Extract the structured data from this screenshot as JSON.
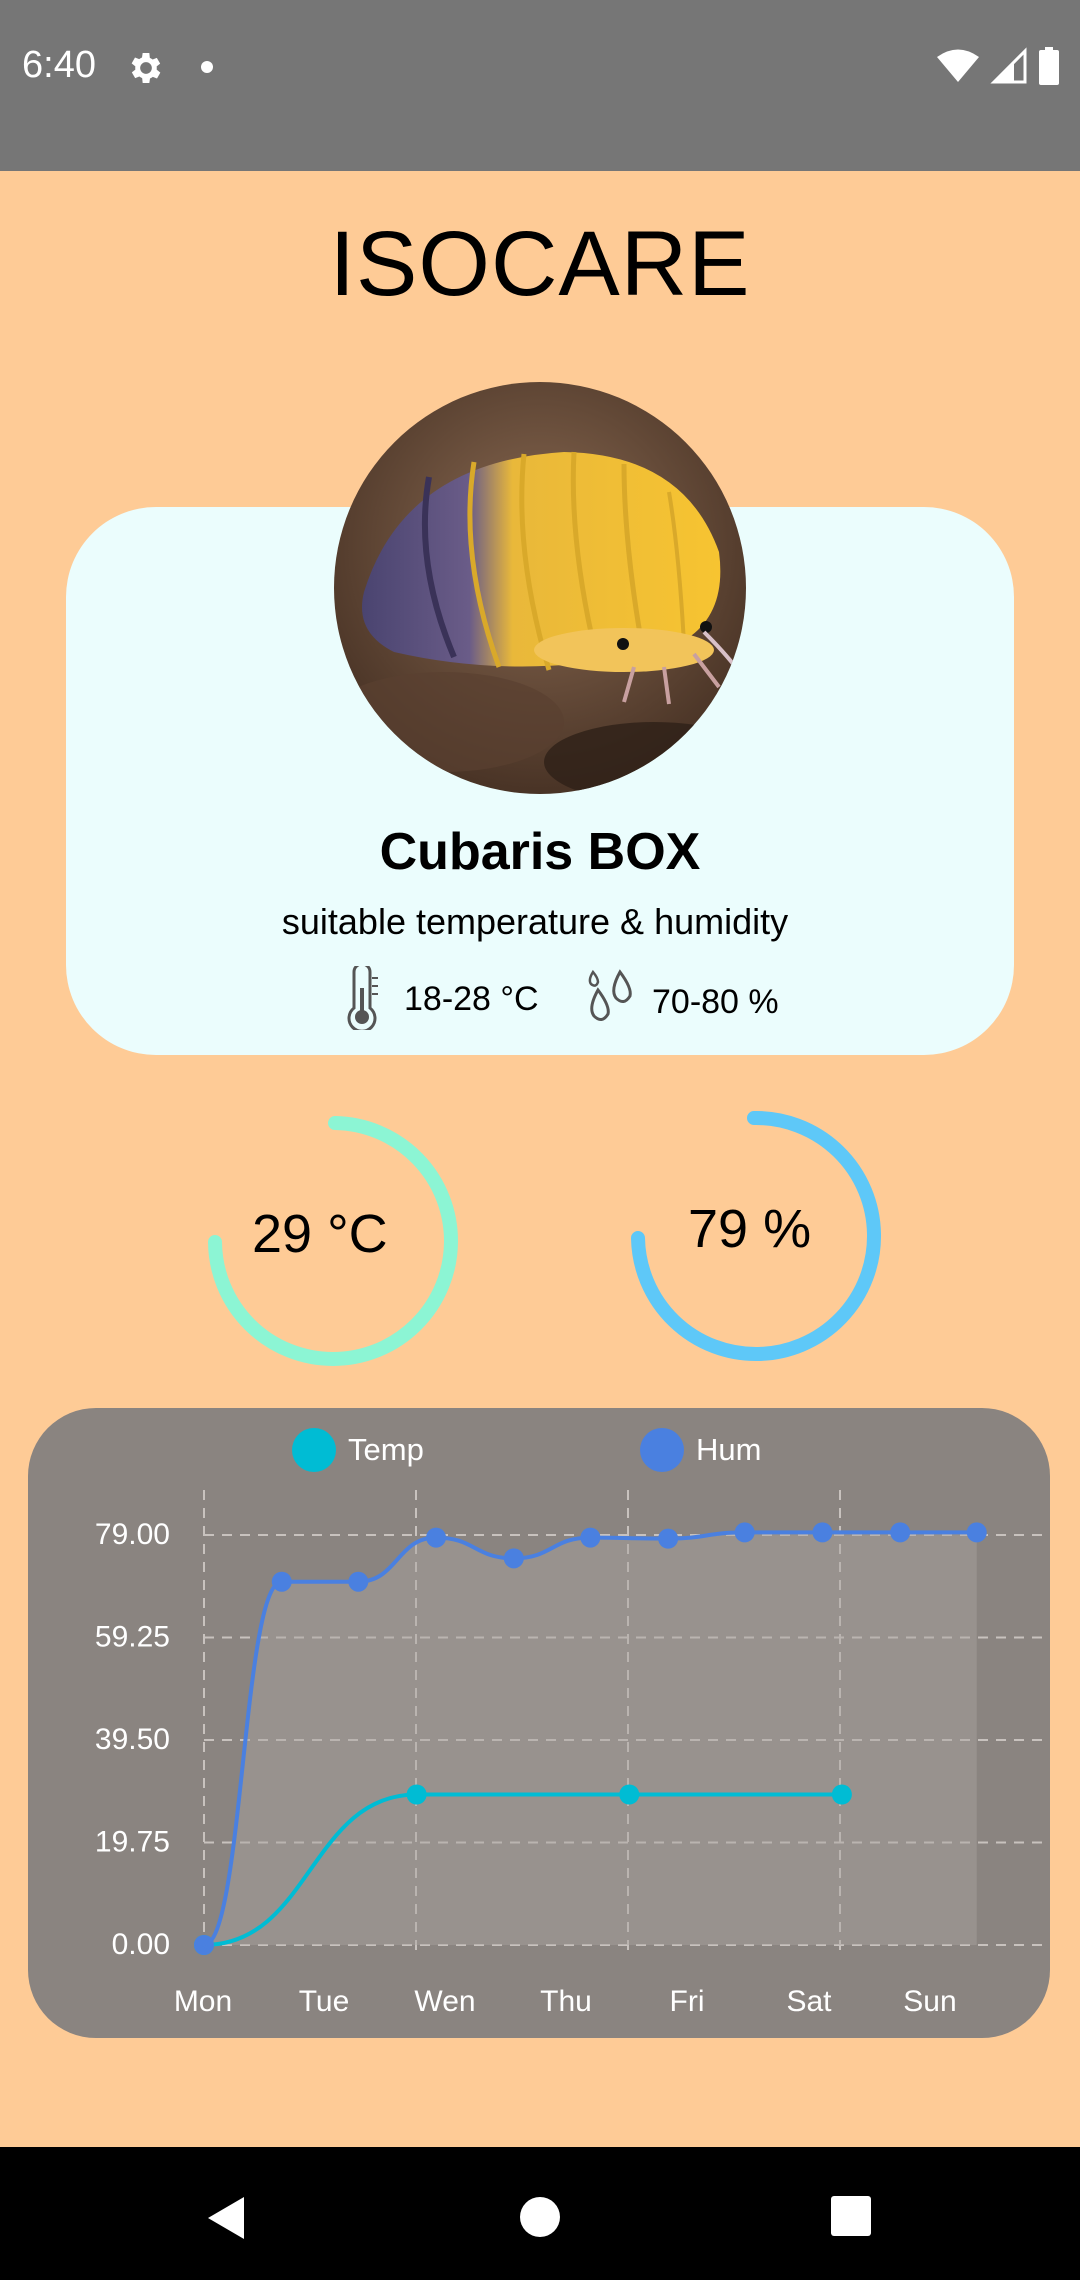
{
  "status": {
    "time": "6:40"
  },
  "app": {
    "title": "ISOCARE"
  },
  "profile": {
    "name": "Cubaris BOX",
    "suitable_label": "suitable temperature & humidity",
    "temp_range": "18-28 °C",
    "hum_range": "70-80 %"
  },
  "gauges": {
    "temperature": {
      "label": "29 °C",
      "color": "#8CF5D4"
    },
    "humidity": {
      "label": "79 %",
      "color": "#5EC8F8"
    }
  },
  "chart_data": {
    "type": "line",
    "categories": [
      "Mon",
      "Tue",
      "Wen",
      "Thu",
      "Fri",
      "Sat",
      "Sun"
    ],
    "y_tick_labels": [
      "79.00",
      "59.25",
      "39.50",
      "19.75",
      "0.00"
    ],
    "ylim": [
      0,
      79
    ],
    "grid": true,
    "legend": "top",
    "series": [
      {
        "name": "Temp",
        "color": "#00BCD4",
        "points": [
          [
            0,
            0
          ],
          [
            1.75,
            29
          ],
          [
            3.5,
            29
          ],
          [
            5.25,
            29
          ]
        ]
      },
      {
        "name": "Hum",
        "color": "#4A80E0",
        "points": [
          [
            0,
            0
          ],
          [
            0.64,
            70
          ],
          [
            1.27,
            70
          ],
          [
            1.91,
            78.5
          ],
          [
            2.55,
            74.5
          ],
          [
            3.18,
            78.5
          ],
          [
            3.82,
            78.3
          ],
          [
            4.45,
            79.5
          ],
          [
            5.09,
            79.5
          ],
          [
            5.73,
            79.5
          ],
          [
            6.36,
            79.5
          ]
        ]
      }
    ]
  }
}
